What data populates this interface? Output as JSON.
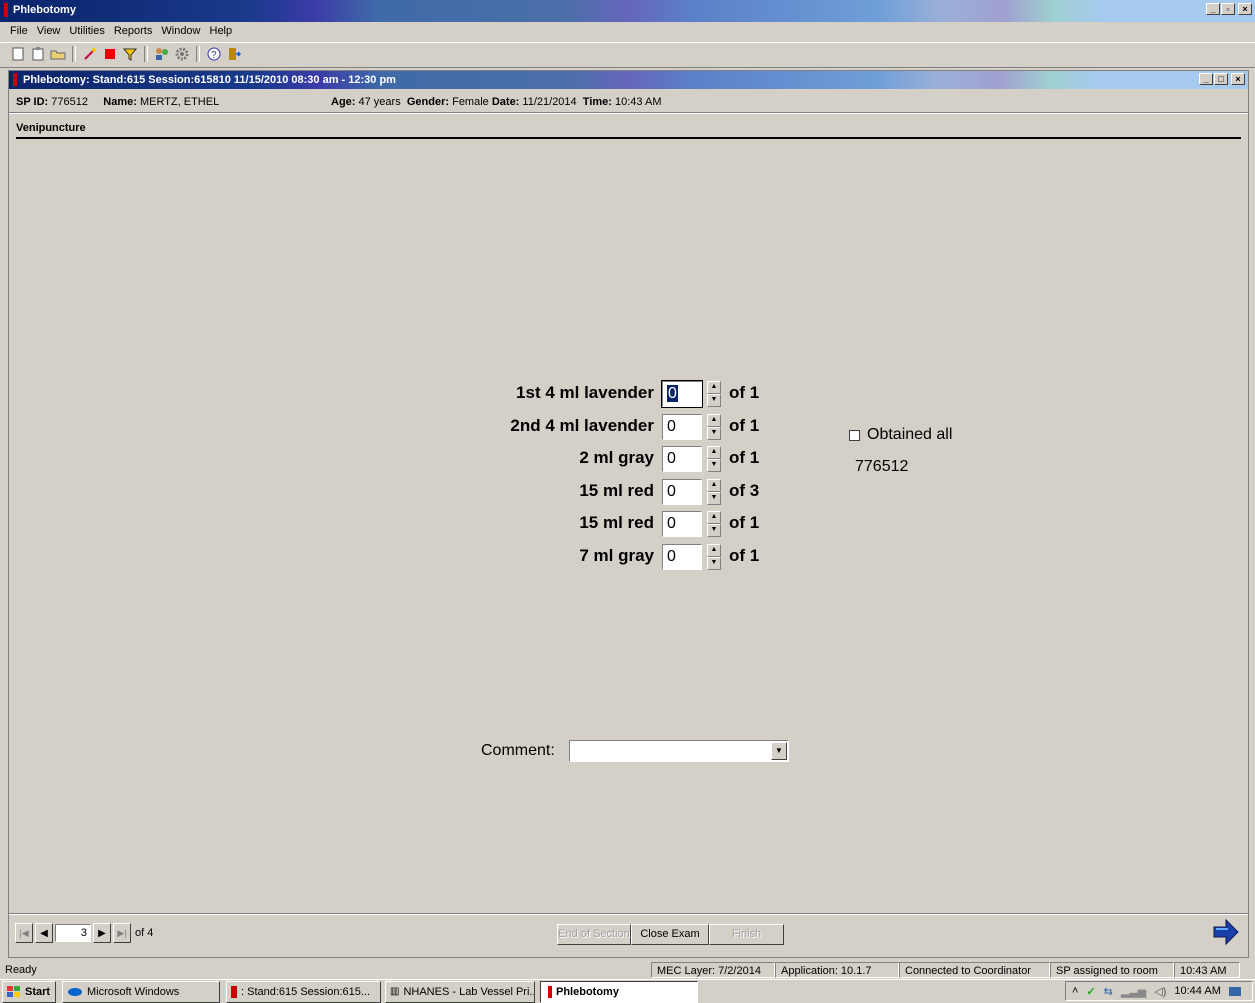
{
  "app": {
    "title": "Phlebotomy",
    "menu": [
      "File",
      "View",
      "Utilities",
      "Reports",
      "Window",
      "Help"
    ]
  },
  "window": {
    "title": "Phlebotomy: Stand:615 Session:615810 11/15/2010 08:30 am - 12:30 pm"
  },
  "sp": {
    "id_label": "SP ID:",
    "id": "776512",
    "name_label": "Name:",
    "name": "MERTZ, ETHEL",
    "age_label": "Age:",
    "age": "47 years",
    "gender_label": "Gender:",
    "gender": "Female",
    "date_label": "Date:",
    "date": "11/21/2014",
    "time_label": "Time:",
    "time": "10:43 AM"
  },
  "section": {
    "title": "Venipuncture"
  },
  "tubes": [
    {
      "label": "1st 4 ml lavender",
      "value": "0",
      "of": "of 1"
    },
    {
      "label": "2nd 4 ml lavender",
      "value": "0",
      "of": "of 1"
    },
    {
      "label": "2 ml gray",
      "value": "0",
      "of": "of 1"
    },
    {
      "label": "15 ml red",
      "value": "0",
      "of": "of 3"
    },
    {
      "label": "15 ml red",
      "value": "0",
      "of": "of 1"
    },
    {
      "label": "7 ml gray",
      "value": "0",
      "of": "of 1"
    }
  ],
  "obtained_all": {
    "label": "Obtained all",
    "checked": false
  },
  "sp_barcode": "776512",
  "comment": {
    "label": "Comment:",
    "value": ""
  },
  "nav": {
    "page": "3",
    "of": "of 4"
  },
  "buttons": {
    "end_section": "End of Section",
    "close_exam": "Close Exam",
    "finish": "Finish"
  },
  "status": {
    "ready": "Ready",
    "mec_layer": "MEC Layer: 7/2/2014",
    "application": "Application: 10.1.7",
    "connected": "Connected to Coordinator",
    "sp_assigned": "SP assigned to room",
    "time": "10:43 AM"
  },
  "taskbar": {
    "start": "Start",
    "items": [
      ": Stand:615 Session:615...",
      "NHANES - Lab Vessel Pri...",
      "Phlebotomy"
    ],
    "quicklaunch": "Microsoft Windows",
    "clock": "10:44 AM"
  },
  "icons": [
    "new-icon",
    "clipboard-icon",
    "open-icon",
    "wand-icon",
    "stop-icon",
    "filter-icon",
    "users-icon",
    "gear-icon",
    "help-icon",
    "exit-icon"
  ]
}
